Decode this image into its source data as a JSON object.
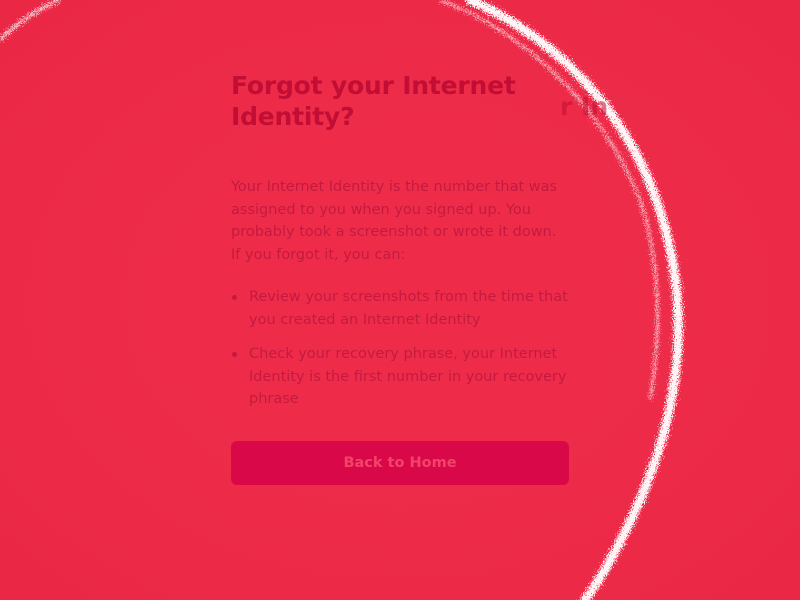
{
  "page": {
    "title": "Forgot your Internet Identity?",
    "description": "Your Internet Identity is the number that was assigned to you when you signed up. You probably took a screenshot or wrote it down. If you forgot it, you can:",
    "tips": [
      "Review your screenshots from the time that you created an Internet Identity",
      "Check your recovery phrase, your Internet Identity is the first number in your recovery phrase"
    ],
    "back_button_label": "Back to Home"
  },
  "ghost": {
    "fragment": "r In"
  },
  "colors": {
    "background": "#ee2c4a",
    "heading": "#c20d34",
    "text": "#c41a40",
    "button_bg": "#d90848",
    "button_text": "#f2446a",
    "transition_ring": "#ffffff"
  }
}
